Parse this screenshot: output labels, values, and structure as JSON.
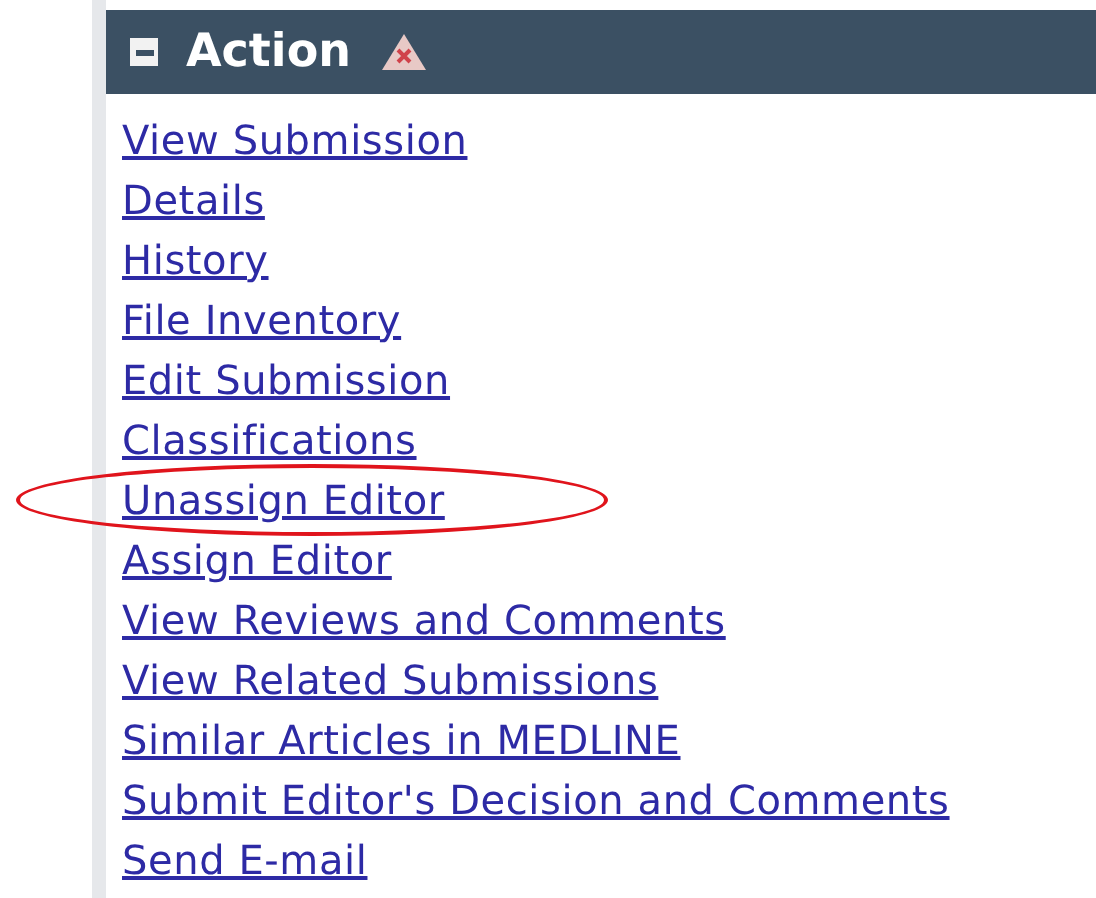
{
  "panel": {
    "title": "Action",
    "expanded": true
  },
  "links": [
    {
      "label": "View Submission",
      "highlighted": false
    },
    {
      "label": "Details",
      "highlighted": false
    },
    {
      "label": "History",
      "highlighted": false
    },
    {
      "label": "File Inventory",
      "highlighted": false
    },
    {
      "label": "Edit Submission",
      "highlighted": false
    },
    {
      "label": "Classifications",
      "highlighted": false
    },
    {
      "label": "Unassign Editor",
      "highlighted": true
    },
    {
      "label": "Assign Editor",
      "highlighted": false
    },
    {
      "label": "View Reviews and Comments",
      "highlighted": false
    },
    {
      "label": "View Related Submissions",
      "highlighted": false
    },
    {
      "label": "Similar Articles in MEDLINE",
      "highlighted": false
    },
    {
      "label": "Submit Editor's Decision and Comments",
      "highlighted": false
    },
    {
      "label": "Send E-mail",
      "highlighted": false
    }
  ]
}
